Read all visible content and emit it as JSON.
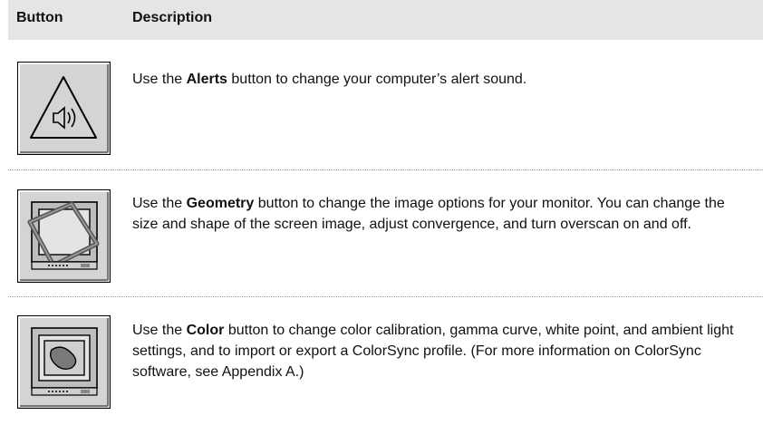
{
  "table": {
    "headers": [
      "Button",
      "Description"
    ],
    "rows": [
      {
        "icon": "alerts-icon",
        "pre": "Use the ",
        "bold": "Alerts",
        "post": " button to change your computer’s alert sound."
      },
      {
        "icon": "geometry-icon",
        "pre": "Use the ",
        "bold": "Geometry",
        "post": " button to change the image options for your monitor. You can change the size and shape of the screen image, adjust convergence, and turn overscan on and off."
      },
      {
        "icon": "color-icon",
        "pre": "Use the ",
        "bold": "Color",
        "post": " button to change color calibration, gamma curve, white point, and ambient light settings, and to import or export a ColorSync profile. (For more information on ColorSync software, see Appendix A.)"
      }
    ]
  },
  "colors": {
    "header_bg": "#e5e5e5",
    "icon_bg": "#d4d4d4",
    "divider": "#9a9a9a"
  }
}
